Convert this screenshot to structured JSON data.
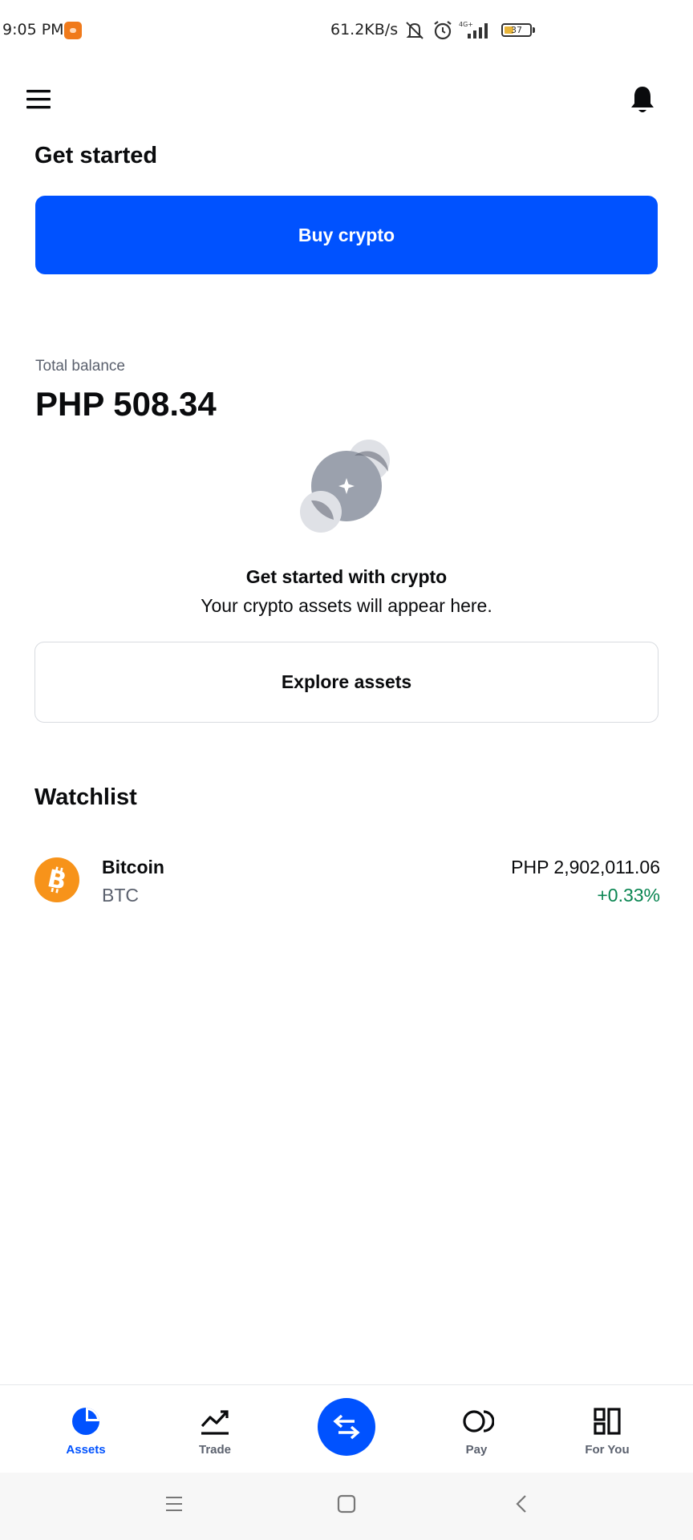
{
  "status_bar": {
    "time": "9:05 PM",
    "network_speed": "61.2KB/s",
    "battery_level": "37",
    "battery_fraction": 0.37,
    "icons": [
      "app-notification-icon",
      "muted-icon",
      "alarm-icon",
      "signal-4g-icon",
      "battery-icon"
    ]
  },
  "header": {
    "menu_icon": "menu-icon",
    "notification_icon": "bell-icon"
  },
  "get_started": {
    "title": "Get started",
    "buy_label": "Buy crypto"
  },
  "balance": {
    "label": "Total balance",
    "value": "PHP 508.34"
  },
  "empty_state": {
    "title": "Get started with crypto",
    "subtitle": "Your crypto assets will appear here.",
    "explore_label": "Explore assets"
  },
  "watchlist": {
    "title": "Watchlist",
    "items": [
      {
        "name": "Bitcoin",
        "symbol": "BTC",
        "price": "PHP 2,902,011.06",
        "change": "+0.33%",
        "icon": "bitcoin-icon"
      }
    ]
  },
  "bottom_nav": {
    "items": [
      {
        "label": "Assets",
        "icon": "pie-chart-icon",
        "active": true
      },
      {
        "label": "Trade",
        "icon": "trend-up-icon",
        "active": false
      },
      {
        "label": "",
        "icon": "swap-icon",
        "active": false
      },
      {
        "label": "Pay",
        "icon": "pay-icon",
        "active": false
      },
      {
        "label": "For You",
        "icon": "grid-icon",
        "active": false
      }
    ]
  },
  "colors": {
    "brand_blue": "#0052ff",
    "positive_green": "#098551",
    "bitcoin_orange": "#f7931a",
    "muted_text": "#5b616e"
  }
}
